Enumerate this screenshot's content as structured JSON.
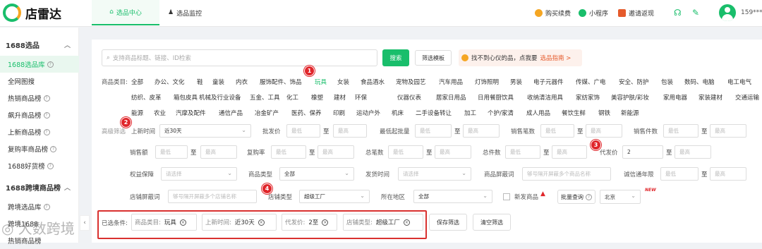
{
  "header": {
    "logo_text": "店雷达",
    "tabs": [
      {
        "label": "选品中心",
        "icon": "home-icon"
      },
      {
        "label": "选品监控",
        "icon": "monitor-icon"
      }
    ],
    "links": [
      {
        "label": "购买续费",
        "color": "#f5a623"
      },
      {
        "label": "小程序",
        "color": "#19be6b"
      },
      {
        "label": "邀请返现",
        "color": "#e55a2b"
      }
    ],
    "username": "159***"
  },
  "sidebar": {
    "groups": [
      {
        "title": "1688选品",
        "items": [
          {
            "label": "1688选品库",
            "active": true,
            "help": true
          },
          {
            "label": "全网图搜",
            "help": false
          },
          {
            "label": "热销商品榜",
            "help": true
          },
          {
            "label": "飙升商品榜",
            "help": true
          },
          {
            "label": "上新商品榜",
            "help": true
          },
          {
            "label": "复购率商品榜",
            "help": true
          },
          {
            "label": "1688好货榜",
            "help": true
          }
        ]
      },
      {
        "title": "1688跨境商品榜",
        "items": [
          {
            "label": "跨境选品库",
            "help": true
          },
          {
            "label": "跨境1688",
            "help": false
          },
          {
            "label": "热销商品榜",
            "help": false
          }
        ]
      }
    ]
  },
  "search": {
    "placeholder": "支持商品标题、链接、ID检索",
    "button": "搜索",
    "template_button": "筛选模板",
    "notice_text": "找不到心仪的品，点我要",
    "notice_link": "选品指南 >"
  },
  "category": {
    "label": "商品类目:",
    "row1": [
      "全部",
      "办公、文化",
      "鞋",
      "童装",
      "内衣",
      "服饰配件、饰品",
      "玩具",
      "女装",
      "食品酒水",
      "宠物及园艺",
      "汽车用品",
      "灯饰照明",
      "男装",
      "电子元器件",
      "传媒、广电",
      "安全、防护",
      "包装",
      "数码、电脑",
      "电工电气"
    ],
    "row2": [
      "纺织、皮革",
      "箱包皮具",
      "机械及行业设备",
      "五金、工具",
      "化工",
      "橡塑",
      "建材",
      "环保",
      "仪器仪表",
      "居家日用品",
      "日用餐厨饮具",
      "收纳清洁用具",
      "家纺家饰",
      "美容护肤/彩妆",
      "家用电器",
      "家装建材",
      "交通运输"
    ],
    "row3": [
      "能源",
      "农业",
      "汽摩及配件",
      "通信产品",
      "冶金矿产",
      "医药、保养",
      "印刷",
      "运动户外",
      "机床",
      "二手设备转让",
      "加工",
      "个护/家清",
      "成人用品",
      "餐饮生鲜",
      "钢铁",
      "新能源"
    ],
    "selected": "玩具"
  },
  "filters": {
    "advanced_label": "高级筛选",
    "shelf_time_label": "上新时间",
    "shelf_time_value": "近30天",
    "wholesale_label": "批发价",
    "min_order_label": "最低起批量",
    "sales_count_label": "销售笔数",
    "sales_units_label": "销售件数",
    "sales_amount_label": "销售额",
    "repurchase_label": "复购率",
    "total_orders_label": "总笔数",
    "total_units_label": "总件数",
    "dropship_label": "代发价",
    "dropship_min": "2",
    "rights_label": "权益保障",
    "rights_placeholder": "请选择",
    "product_type_label": "商品类型",
    "product_type_value": "全部",
    "ship_time_label": "发货时间",
    "ship_time_placeholder": "请选择",
    "block_words_label": "商品屏蔽词",
    "block_words_placeholder": "够号隔开屏蔽多个商品名称",
    "integrity_label": "诚信通年限",
    "shop_block_label": "店铺屏蔽词",
    "shop_block_placeholder": "够号隔开屏蔽多个店铺名称",
    "shop_type_label": "店铺类型",
    "shop_type_value": "超级工厂",
    "region_label": "所在地区",
    "region_value": "全部",
    "new_product_label": "新发商品",
    "batch_query_label": "批量查询",
    "city_value": "北京",
    "new_badge": "NEW",
    "min_placeholder": "最低",
    "max_placeholder": "最高",
    "to": "至"
  },
  "selected_conditions": {
    "label": "已选条件:",
    "chips": [
      {
        "key": "商品类目:",
        "value": "玩具"
      },
      {
        "key": "上新时间:",
        "value": "近30天"
      },
      {
        "key": "代发价:",
        "value": "2至"
      },
      {
        "key": "店铺类型:",
        "value": "超级工厂"
      }
    ],
    "save_button": "保存筛选",
    "clear_button": "清空筛选"
  },
  "annotations": [
    "1",
    "2",
    "3",
    "4"
  ],
  "watermark": "◎ 大数跨境"
}
